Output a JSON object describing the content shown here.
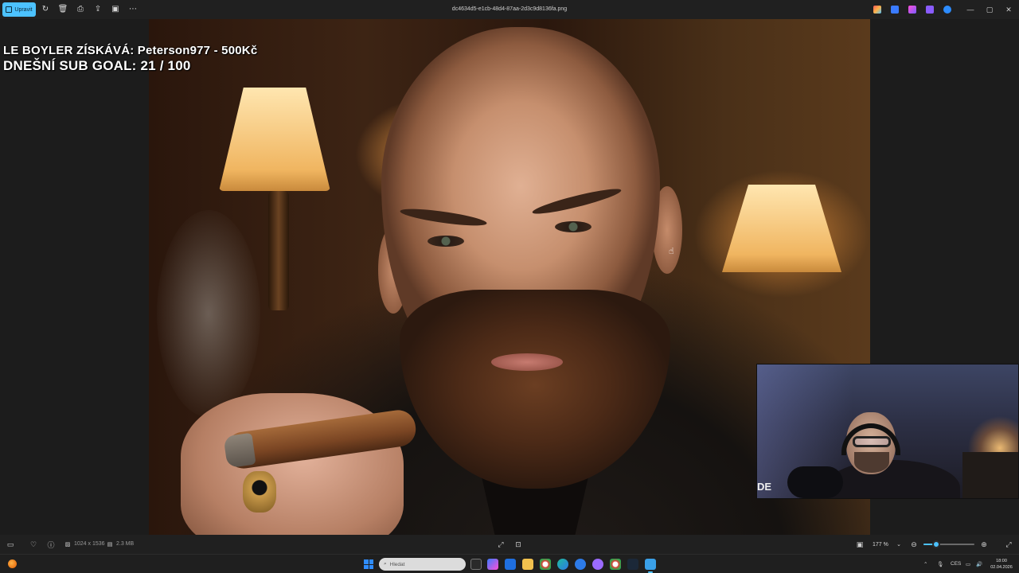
{
  "toolbar": {
    "edit_label": "Upravit",
    "filename": "dc4634d5-e1cb-48d4-87aa-2d3c9d8136fa.png",
    "tools": [
      "rotate-icon",
      "delete-icon",
      "print-icon",
      "share-icon",
      "fit-icon",
      "more-icon"
    ]
  },
  "overlay": {
    "line1": "LE BOYLER ZÍSKÁVÁ: Peterson977 - 500Kč",
    "line2": "DNEŠNÍ SUB GOAL:  21 / 100"
  },
  "webcam": {
    "label": "DE"
  },
  "statusbar": {
    "dimensions": "1024 x 1536",
    "file_size": "2.3 MB",
    "zoom": "177 %",
    "zoom_fraction": 0.25
  },
  "taskbar": {
    "search_placeholder": "Hledat",
    "language": "CES",
    "time": "18:00",
    "date": "02.04.2026"
  },
  "colors": {
    "accent": "#4cc2ff",
    "background": "#1c1c1c",
    "bar": "#202020"
  }
}
